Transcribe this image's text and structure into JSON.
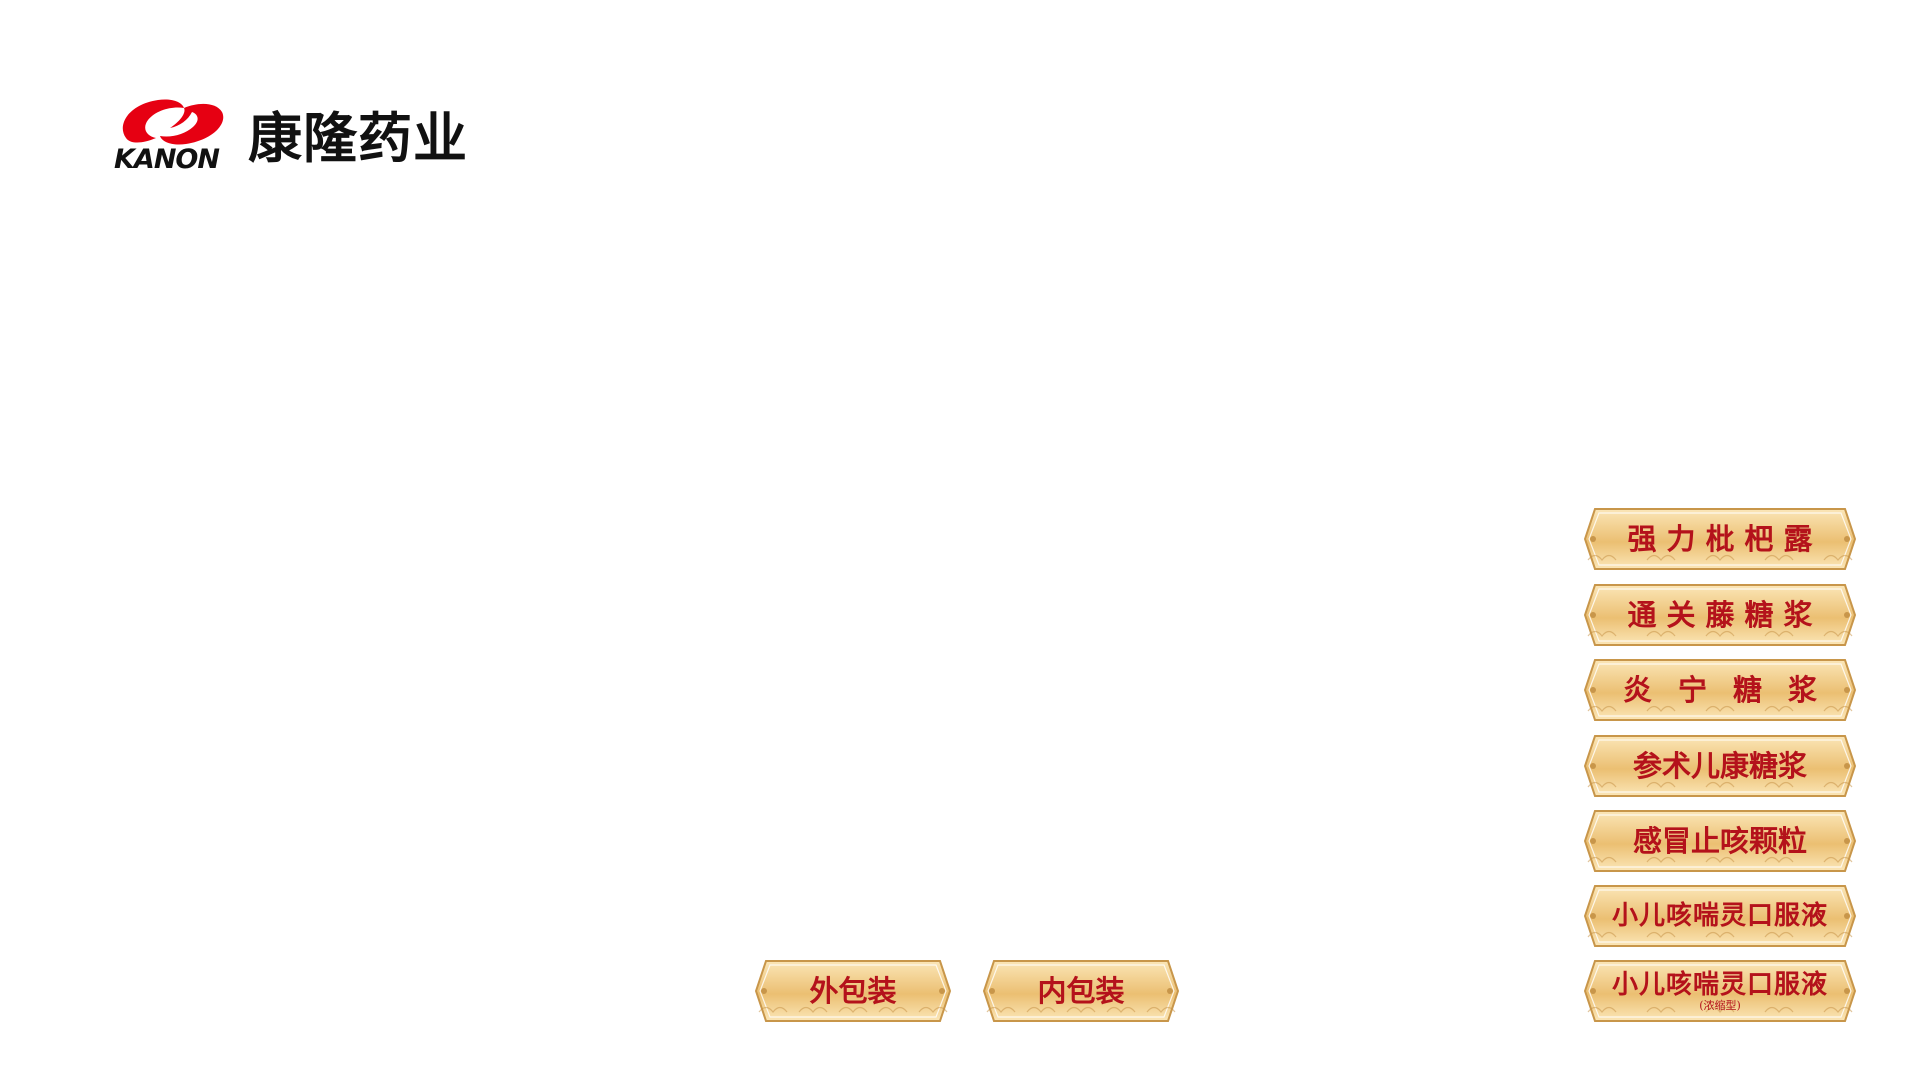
{
  "brand": {
    "logo_en": "KANON",
    "logo_cn": "康隆药业",
    "mark_color": "#e60012"
  },
  "theme": {
    "button_text_color": "#b4121b",
    "button_fill_light": "#fbe6b7",
    "button_fill_dark": "#ebbf72",
    "button_border": "#c8964a"
  },
  "side_menu": {
    "items": [
      {
        "label": "强力枇杷露"
      },
      {
        "label": "通关藤糖浆"
      },
      {
        "label": "炎宁糖浆"
      },
      {
        "label": "参术儿康糖浆"
      },
      {
        "label": "感冒止咳颗粒"
      },
      {
        "label": "小儿咳喘灵口服液"
      },
      {
        "label": "小儿咳喘灵口服液",
        "sub": "(浓缩型)"
      }
    ]
  },
  "packaging": {
    "outer_label": "外包装",
    "inner_label": "内包装"
  }
}
